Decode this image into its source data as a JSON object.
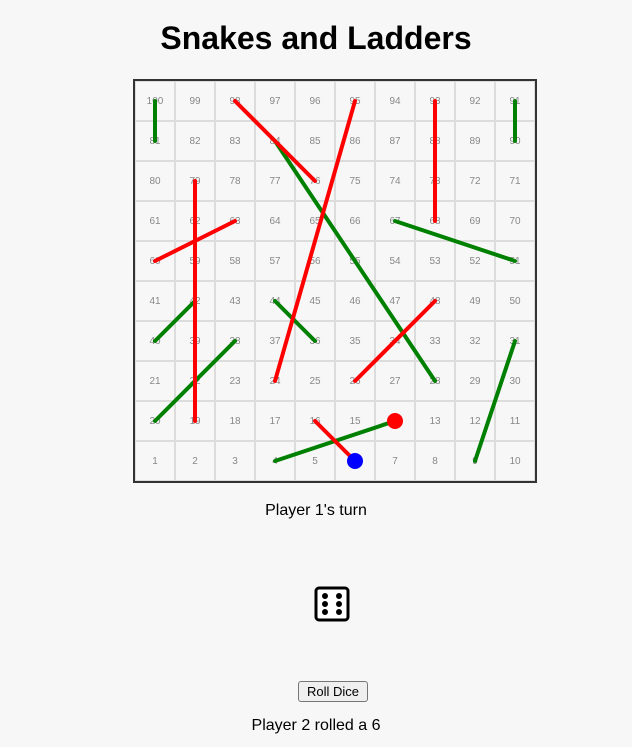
{
  "title": "Snakes and Ladders",
  "turn_text": "Player 1's turn",
  "dice_icon": "die-face-six-icon",
  "roll_button_label": "Roll Dice",
  "result_text": "Player 2 rolled a 6",
  "colors": {
    "ladder": "#008000",
    "snake": "#ff0000",
    "player1": "#0000ff",
    "player2": "#ff0000"
  },
  "board": {
    "rows": [
      [
        100,
        99,
        98,
        97,
        96,
        95,
        94,
        93,
        92,
        91
      ],
      [
        81,
        82,
        83,
        84,
        85,
        86,
        87,
        88,
        89,
        90
      ],
      [
        80,
        79,
        78,
        77,
        76,
        75,
        74,
        73,
        72,
        71
      ],
      [
        61,
        62,
        63,
        64,
        65,
        66,
        67,
        68,
        69,
        70
      ],
      [
        60,
        59,
        58,
        57,
        56,
        55,
        54,
        53,
        52,
        51
      ],
      [
        41,
        42,
        43,
        44,
        45,
        46,
        47,
        48,
        49,
        50
      ],
      [
        40,
        39,
        38,
        37,
        36,
        35,
        34,
        33,
        32,
        31
      ],
      [
        21,
        22,
        23,
        24,
        25,
        26,
        27,
        28,
        29,
        30
      ],
      [
        20,
        19,
        18,
        17,
        16,
        15,
        14,
        13,
        12,
        11
      ],
      [
        1,
        2,
        3,
        4,
        5,
        6,
        7,
        8,
        9,
        10
      ]
    ],
    "ladders": [
      {
        "from": 100,
        "to": 81
      },
      {
        "from": 91,
        "to": 90
      },
      {
        "from": 84,
        "to": 28
      },
      {
        "from": 67,
        "to": 51
      },
      {
        "from": 40,
        "to": 42
      },
      {
        "from": 20,
        "to": 38
      },
      {
        "from": 44,
        "to": 36
      },
      {
        "from": 4,
        "to": 14
      },
      {
        "from": 9,
        "to": 31
      }
    ],
    "snakes": [
      {
        "from": 98,
        "to": 76
      },
      {
        "from": 95,
        "to": 24
      },
      {
        "from": 93,
        "to": 68
      },
      {
        "from": 79,
        "to": 19
      },
      {
        "from": 63,
        "to": 60
      },
      {
        "from": 48,
        "to": 26
      },
      {
        "from": 16,
        "to": 6
      }
    ],
    "players": [
      {
        "name": "Player 1",
        "square": 6
      },
      {
        "name": "Player 2",
        "square": 14
      }
    ]
  }
}
